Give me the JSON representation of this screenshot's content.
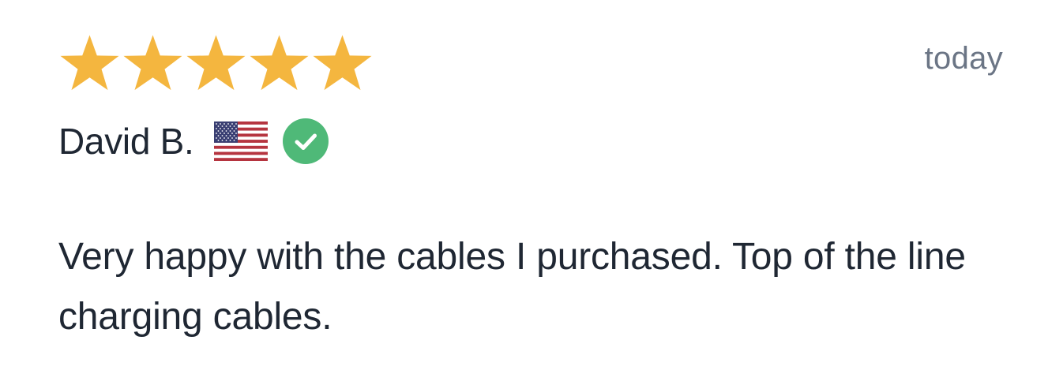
{
  "review": {
    "rating": 5,
    "rating_max": 5,
    "date": "today",
    "author": "David B.",
    "country_flag_icon": "us-flag-icon",
    "verified_icon": "verified-check-icon",
    "text": "Very happy with the cables I purchased. Top of the line charging cables."
  },
  "colors": {
    "star": "#F4B63F",
    "verified": "#4FB978",
    "text": "#1F2733",
    "date": "#6B7585"
  }
}
